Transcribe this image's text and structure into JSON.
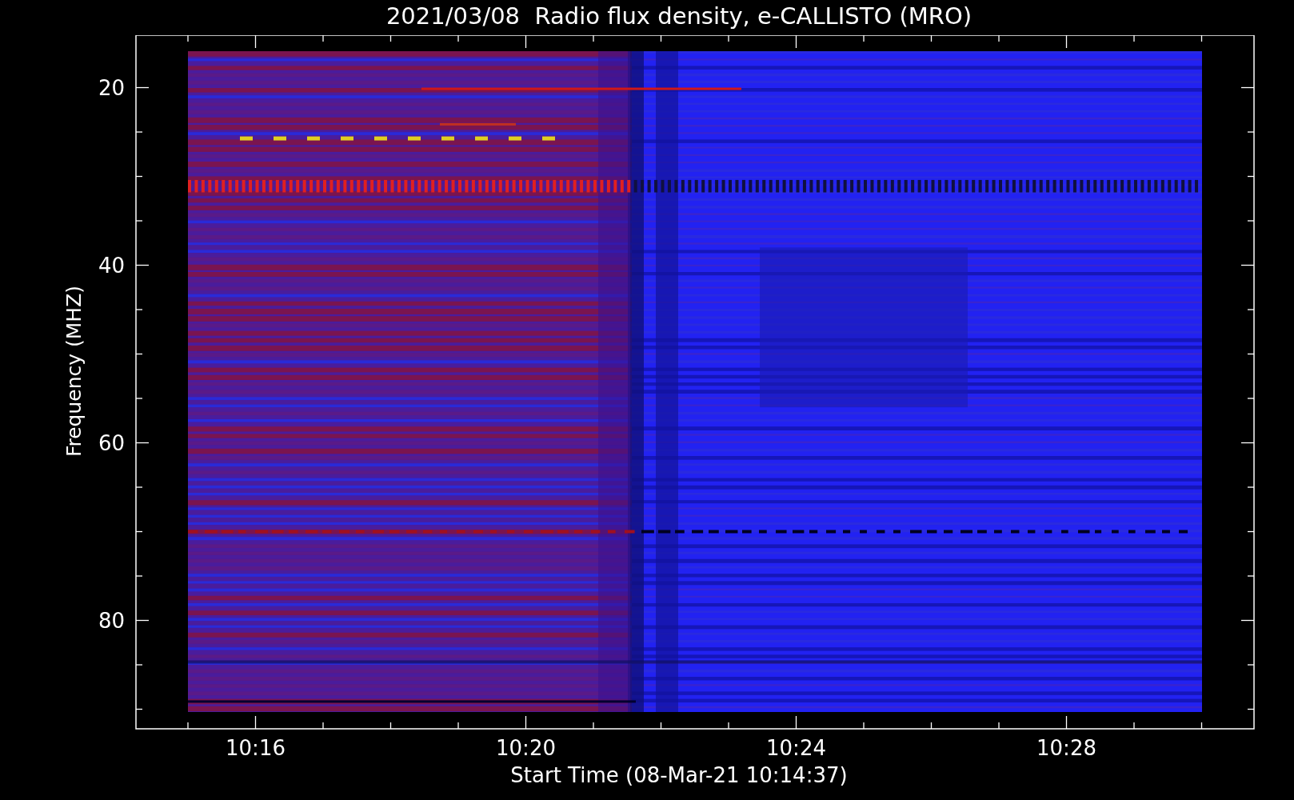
{
  "title": "2021/03/08  Radio flux density, e-CALLISTO (MRO)",
  "y_axis": {
    "label": "Frequency (MHZ)",
    "ticks": [
      "20",
      "40",
      "60",
      "80"
    ]
  },
  "x_axis": {
    "label": "Start Time (08-Mar-21 10:14:37)",
    "ticks": [
      "10:16",
      "10:20",
      "10:24",
      "10:28"
    ]
  }
}
